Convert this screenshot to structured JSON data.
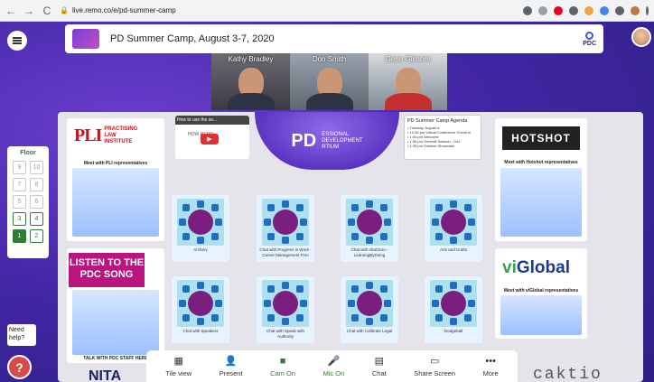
{
  "browser": {
    "url": "live.remo.co/e/pd-summer-camp",
    "back": "←",
    "forward": "→",
    "reload": "C"
  },
  "topbar": {
    "title": "PD Summer Camp, August 3-7, 2020",
    "logo_text": "PDC"
  },
  "videos": [
    {
      "name": "Kathy Bradley"
    },
    {
      "name": "Don Smith"
    },
    {
      "name": "Gene Gilmore"
    }
  ],
  "floors": {
    "label": "Floor",
    "items": [
      "9",
      "10",
      "7",
      "8",
      "5",
      "6",
      "3",
      "4",
      "1",
      "2"
    ],
    "available": [
      "3",
      "4",
      "2"
    ],
    "current": "1"
  },
  "help": {
    "label": "Need help?",
    "icon": "?"
  },
  "sponsors": {
    "pli": {
      "logo_main": "PLI",
      "logo_sub": "PRACTISING\nLAW\nINSTITUTE",
      "caption": "Meet with PLI representatives"
    },
    "hotshot": {
      "logo": "HOTSHOT",
      "caption": "Meet with Hotshot representatives"
    },
    "viglobal": {
      "logo_v": "vi",
      "logo_rest": "Global",
      "caption": "Meet with viGlobal representatives"
    },
    "song": {
      "text": "LISTEN TO THE PDC SONG",
      "caption": "TALK WITH PDC STAFF HERE"
    }
  },
  "banner": {
    "text": "PD",
    "sub": "ESSIONAL\nDEVELOPMENT\nRTIUM"
  },
  "video_embed": {
    "title": "How to use the se...",
    "sub": "HOW          REMO",
    "play": "▶"
  },
  "agenda": {
    "title": "PD Summer Camp Agenda",
    "items": [
      "• Tuesday, August 4:",
      "• 12:30 pm Virtual Conference Check-in",
      "• 1:00 pm Welcome",
      "• 1:05 pm General Session - D&I",
      "• 1:35 pm Solution Showcase"
    ]
  },
  "tables": [
    {
      "label": "Archery"
    },
    {
      "label": "Chat with Progress in Work - Career Management Firm"
    },
    {
      "label": "Chat with AltaClaro - LearningByDoing"
    },
    {
      "label": "Arts and Crafts"
    },
    {
      "label": "Chat with Speakers"
    },
    {
      "label": "Chat with Speak with Authority"
    },
    {
      "label": "Chat with Calibrate Legal"
    },
    {
      "label": "Dodgeball"
    }
  ],
  "toolbar": [
    {
      "label": "Tile view",
      "icon": "▦",
      "state": "normal"
    },
    {
      "label": "Present",
      "icon": "👤",
      "state": "normal"
    },
    {
      "label": "Cam On",
      "icon": "■",
      "state": "green"
    },
    {
      "label": "Mic On",
      "icon": "🎤",
      "state": "green"
    },
    {
      "label": "Chat",
      "icon": "▤",
      "state": "normal"
    },
    {
      "label": "Share Screen",
      "icon": "▭",
      "state": "normal"
    },
    {
      "label": "More",
      "icon": "•••",
      "state": "normal"
    }
  ],
  "footer_logos": {
    "nita": "NITA",
    "faded": "caktio"
  }
}
